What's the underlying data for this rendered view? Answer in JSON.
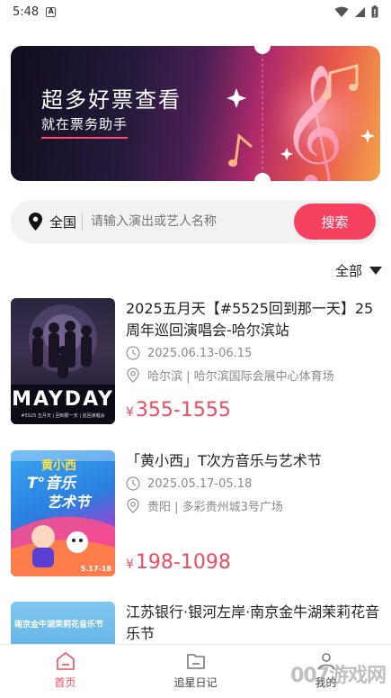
{
  "status_bar": {
    "time": "5:48",
    "notification_letter": "A"
  },
  "banner": {
    "title": "超多好票查看",
    "subtitle": "就在票务助手"
  },
  "search": {
    "location": "全国",
    "placeholder": "请输入演出或艺人名称",
    "button_label": "搜索"
  },
  "filter": {
    "label": "全部"
  },
  "events": [
    {
      "title": "2025五月天【#5525回到那一天】25周年巡回演唱会-哈尔滨站",
      "date": "2025.06.13-06.15",
      "venue": "哈尔滨 | 哈尔滨国际会展中心体育场",
      "currency": "¥",
      "price": "355-1555",
      "poster_text": "MAYDAY",
      "poster_caption": "#5525 五月天 | 回到那一天 | 巡回演唱会"
    },
    {
      "title": "「黄小西」T次方音乐与艺术节",
      "date": "2025.05.17-05.18",
      "venue": "贵阳 | 多彩贵州城3号广场",
      "currency": "¥",
      "price": "198-1098",
      "poster_text_1": "黄小西",
      "poster_text_2": "T°音乐",
      "poster_text_3": "艺术节",
      "poster_date": "5.17-18"
    },
    {
      "title": "江苏银行·银河左岸·南京金牛湖茉莉花音乐节",
      "poster_text_1": "南京金牛湖茉莉花音乐节"
    }
  ],
  "tabs": [
    {
      "label": "首页",
      "icon": "home-icon"
    },
    {
      "label": "追星日记",
      "icon": "folder-icon"
    },
    {
      "label": "我的",
      "icon": "user-icon"
    }
  ],
  "watermark": "007游戏网",
  "colors": {
    "accent": "#f5405f",
    "price": "#ef4c61"
  }
}
